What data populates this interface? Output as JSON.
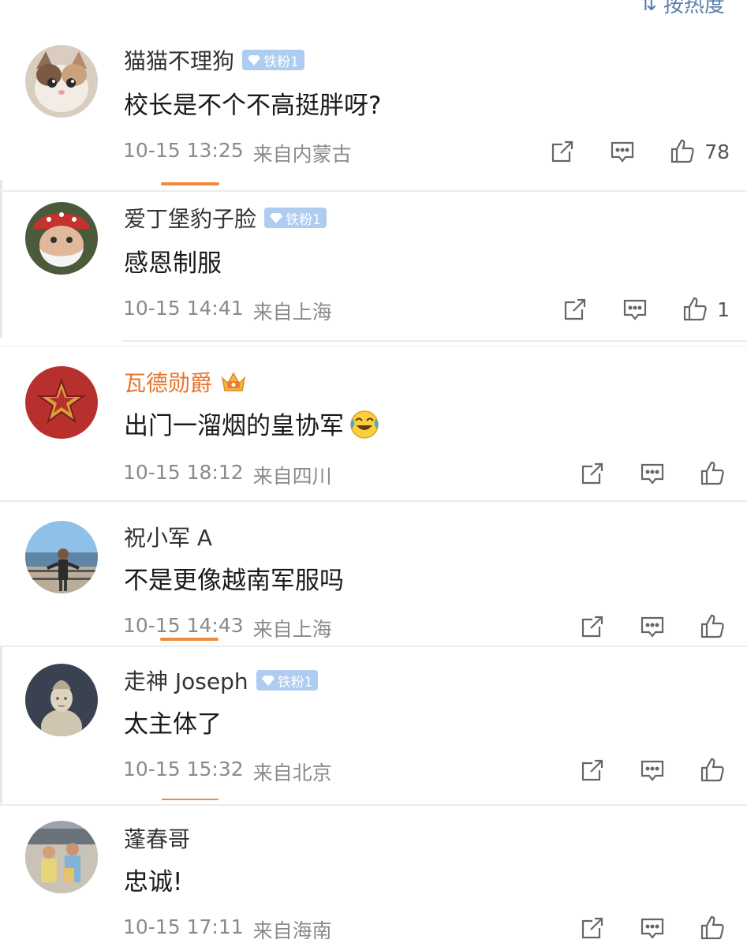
{
  "sort": {
    "label": "按热度",
    "icon": "sort-icon"
  },
  "comments": [
    {
      "username": "猫猫不理狗",
      "badge": "铁粉1",
      "text": "校长是不个不高挺胖呀?",
      "date": "10-15 13:25",
      "location": "来自内蒙古",
      "likes": "78"
    },
    {
      "username": "爱丁堡豹子脸",
      "badge": "铁粉1",
      "text": "感恩制服",
      "date": "10-15 14:41",
      "location": "来自上海",
      "likes": "1"
    },
    {
      "username": "瓦德勋爵",
      "badge": "",
      "text": "出门一溜烟的皇协军",
      "date": "10-15 18:12",
      "location": "来自四川",
      "likes": ""
    },
    {
      "username": "祝小军 A",
      "badge": "",
      "text": "不是更像越南军服吗",
      "date": "10-15 14:43",
      "location": "来自上海",
      "likes": ""
    },
    {
      "username": "走神 Joseph",
      "badge": "铁粉1",
      "text": "太主体了",
      "date": "10-15 15:32",
      "location": "来自北京",
      "likes": ""
    },
    {
      "username": "蓬春哥",
      "badge": "",
      "text": "忠诚!",
      "date": "10-15 17:11",
      "location": "来自海南",
      "likes": ""
    }
  ],
  "colors": {
    "vip_name": "#e8742c",
    "badge_bg": "#aecbf0",
    "meta": "#8a8a8a",
    "accent": "#f08a3b"
  }
}
